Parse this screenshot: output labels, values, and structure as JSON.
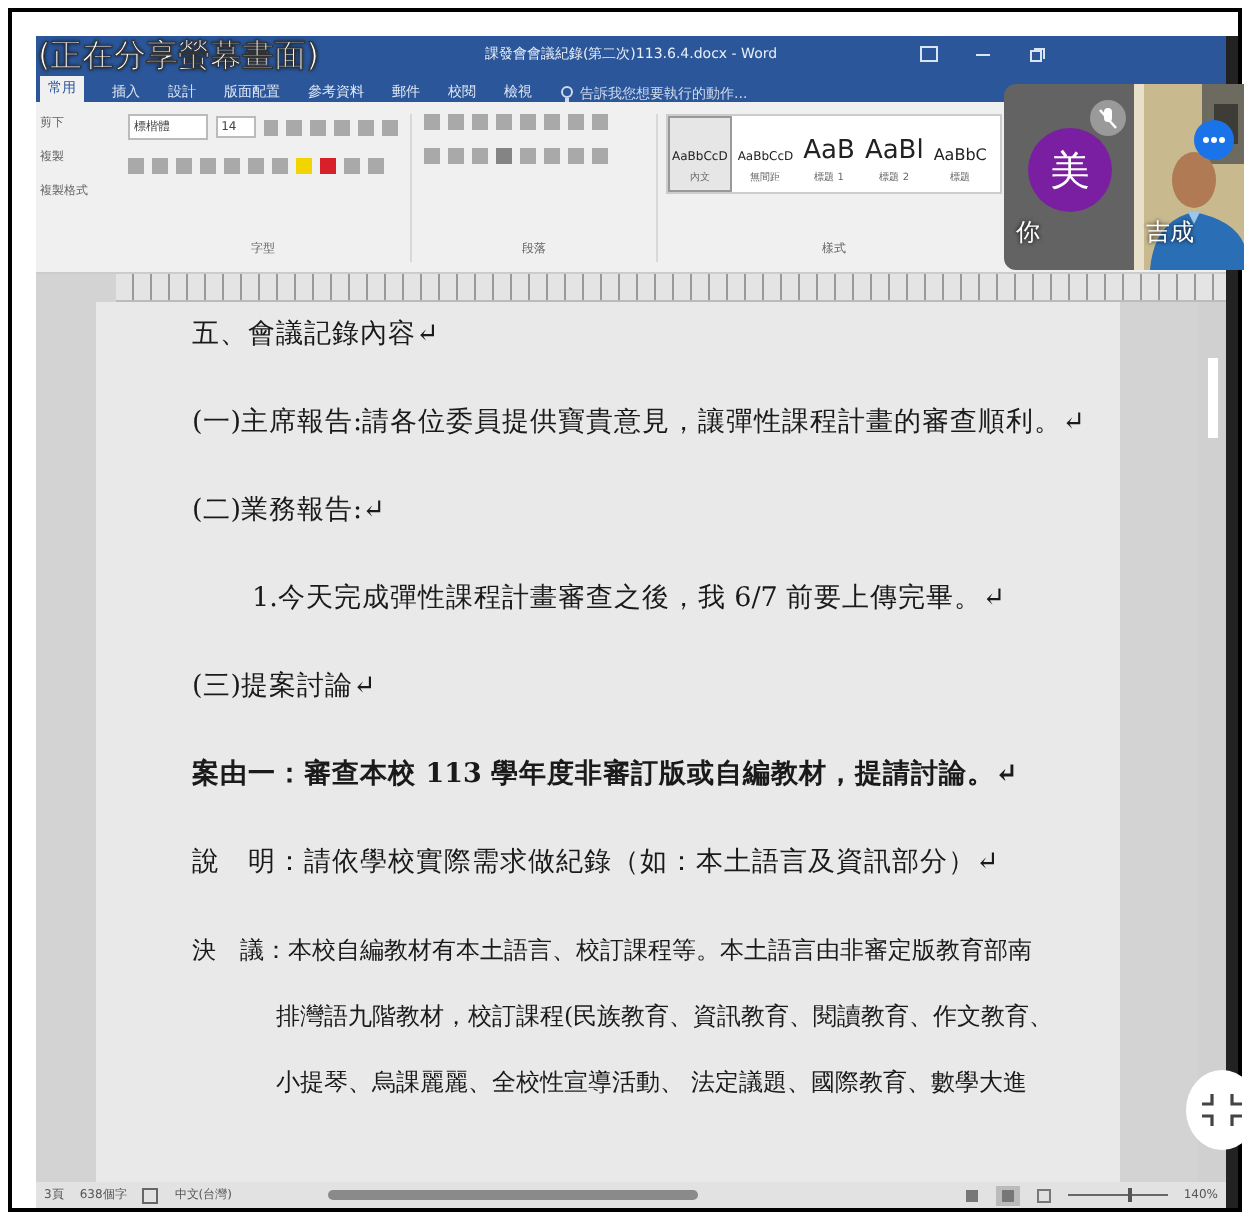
{
  "share_banner": "(正在分享螢幕畫面)",
  "window": {
    "title": "課發會會議紀錄(第二次)113.6.4.docx - Word"
  },
  "tabs": [
    {
      "label": "常用",
      "selected": true
    },
    {
      "label": "插入",
      "selected": false
    },
    {
      "label": "設計",
      "selected": false
    },
    {
      "label": "版面配置",
      "selected": false
    },
    {
      "label": "參考資料",
      "selected": false
    },
    {
      "label": "郵件",
      "selected": false
    },
    {
      "label": "校閱",
      "selected": false
    },
    {
      "label": "檢視",
      "selected": false
    }
  ],
  "tell_me": {
    "placeholder": "告訴我您想要執行的動作..."
  },
  "clipboard": [
    "剪下",
    "複製",
    "複製格式"
  ],
  "font": {
    "name": "標楷體",
    "size": "14"
  },
  "groups": [
    "字型",
    "段落",
    "樣式"
  ],
  "styles": [
    {
      "sample": "AaBbCcD",
      "label": "內文",
      "selected": true,
      "kind": "small"
    },
    {
      "sample": "AaBbCcD",
      "label": "無間距",
      "selected": false,
      "kind": "small"
    },
    {
      "sample": "AaB",
      "label": "標題 1",
      "selected": false,
      "kind": "large"
    },
    {
      "sample": "AaBl",
      "label": "標題 2",
      "selected": false,
      "kind": "large"
    },
    {
      "sample": "AaBbC",
      "label": "標題",
      "selected": false,
      "kind": "medium"
    }
  ],
  "document": [
    {
      "kind": "heading",
      "text": "五、會議記錄內容↵"
    },
    {
      "kind": "para",
      "text": "(一)主席報告:請各位委員提供寶貴意見，讓彈性課程計畫的審查順利。↵"
    },
    {
      "kind": "para",
      "text": "(二)業務報告:↵"
    },
    {
      "kind": "item",
      "text": "1.今天完成彈性課程計畫審查之後，我 6/7 前要上傳完畢。↵"
    },
    {
      "kind": "para",
      "text": "(三)提案討論↵"
    },
    {
      "kind": "bold",
      "text": "案由一：審查本校 113 學年度非審訂版或自編教材，提請討論。↵"
    },
    {
      "kind": "para",
      "text": "說　明：請依學校實際需求做紀錄（如：本土語言及資訊部分）↵"
    },
    {
      "kind": "para",
      "text": "決　議：本校自編教材有本土語言、校訂課程等。本土語言由非審定版教育部南"
    },
    {
      "kind": "cont",
      "text": "排灣語九階教材，校訂課程(民族教育、資訊教育、閱讀教育、作文教育、"
    },
    {
      "kind": "cont",
      "text": "小提琴、烏課麗麗、全校性宣導活動、 法定議題、國際教育、數學大進"
    }
  ],
  "status_bar": {
    "pages": "3頁",
    "words": "638個字",
    "language": "中文(台灣)",
    "zoom": "140%",
    "zoom_slider": {
      "level": 0.6
    }
  },
  "participants": [
    {
      "kind": "avatar",
      "initial": "美",
      "name": "你",
      "muted": true
    },
    {
      "kind": "video",
      "name": "吉成",
      "muted": false
    }
  ]
}
